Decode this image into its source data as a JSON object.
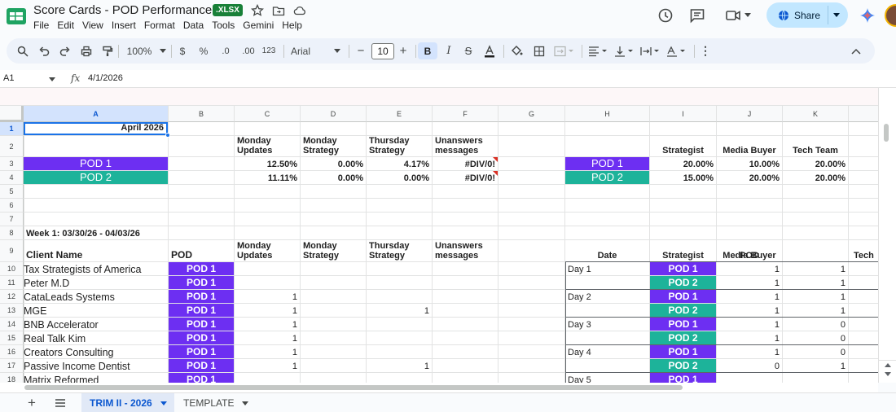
{
  "doc": {
    "title": "Score Cards - POD Performance",
    "format_badge": ".XLSX"
  },
  "menu": [
    "File",
    "Edit",
    "View",
    "Insert",
    "Format",
    "Data",
    "Tools",
    "Gemini",
    "Help"
  ],
  "share": {
    "label": "Share"
  },
  "toolbar": {
    "zoom": "100%",
    "currency": "$",
    "percent": "%",
    "dec_decrease": ".0",
    "dec_increase": ".00",
    "number_format": "123",
    "font": "Arial",
    "font_size": "10",
    "bold": "B"
  },
  "formula_bar": {
    "cell_ref": "A1",
    "fx": "fx",
    "value": "4/1/2026"
  },
  "columns": [
    "A",
    "B",
    "C",
    "D",
    "E",
    "F",
    "G",
    "H",
    "I",
    "J",
    "K"
  ],
  "rows": [
    "1",
    "2",
    "3",
    "4",
    "5",
    "6",
    "7",
    "8",
    "9",
    "10",
    "11",
    "12",
    "13",
    "14",
    "15",
    "16",
    "17",
    "18"
  ],
  "summary": {
    "month": "April 2026",
    "headers": [
      [
        "Monday",
        "Updates"
      ],
      [
        "Monday",
        "Strategy"
      ],
      [
        "Thursday",
        "Strategy"
      ],
      [
        "Unanswers",
        "messages"
      ]
    ],
    "pods": [
      {
        "name": "POD 1",
        "values": [
          "12.50%",
          "0.00%",
          "4.17%",
          "#DIV/0!"
        ]
      },
      {
        "name": "POD 2",
        "values": [
          "11.11%",
          "0.00%",
          "0.00%",
          "#DIV/0!"
        ]
      }
    ],
    "role_headers": [
      "Strategist",
      "Media Buyer",
      "Tech Team"
    ],
    "role_pods": [
      {
        "name": "POD 1",
        "values": [
          "20.00%",
          "10.00%",
          "20.00%"
        ]
      },
      {
        "name": "POD 2",
        "values": [
          "15.00%",
          "20.00%",
          "20.00%"
        ]
      }
    ]
  },
  "week": {
    "title": "Week 1: 03/30/26 - 04/03/26",
    "client_header": "Client Name",
    "pod_header": "POD",
    "clients": [
      {
        "name": "Tax Strategists of America",
        "pod": "POD 1",
        "mu": "",
        "ms": "",
        "ts": "",
        "um": ""
      },
      {
        "name": "Peter M.D",
        "pod": "POD 1",
        "mu": "",
        "ms": "",
        "ts": "",
        "um": ""
      },
      {
        "name": "CataLeads Systems",
        "pod": "POD 1",
        "mu": "1",
        "ms": "",
        "ts": "",
        "um": ""
      },
      {
        "name": "MGE",
        "pod": "POD 1",
        "mu": "1",
        "ms": "",
        "ts": "1",
        "um": ""
      },
      {
        "name": "BNB Accelerator",
        "pod": "POD 1",
        "mu": "1",
        "ms": "",
        "ts": "",
        "um": ""
      },
      {
        "name": "Real Talk Kim",
        "pod": "POD 1",
        "mu": "1",
        "ms": "",
        "ts": "",
        "um": ""
      },
      {
        "name": "Creators Consulting",
        "pod": "POD 1",
        "mu": "1",
        "ms": "",
        "ts": "",
        "um": ""
      },
      {
        "name": "Passive Income Dentist",
        "pod": "POD 1",
        "mu": "1",
        "ms": "",
        "ts": "1",
        "um": ""
      },
      {
        "name": "Matrix Reformed",
        "pod": "POD 1",
        "mu": "",
        "ms": "",
        "ts": "",
        "um": ""
      }
    ],
    "daily_headers": {
      "date": "Date",
      "pod": "POD",
      "strategist": "Strategist",
      "media_buyer": "Media Buyer",
      "tech": "Tech"
    },
    "daily": [
      {
        "day": "Day 1",
        "pod": "POD 1",
        "strategist": "1",
        "media_buyer": "1"
      },
      {
        "day": "",
        "pod": "POD 2",
        "strategist": "1",
        "media_buyer": "1"
      },
      {
        "day": "Day 2",
        "pod": "POD 1",
        "strategist": "1",
        "media_buyer": "1"
      },
      {
        "day": "",
        "pod": "POD 2",
        "strategist": "1",
        "media_buyer": "1"
      },
      {
        "day": "Day 3",
        "pod": "POD 1",
        "strategist": "1",
        "media_buyer": "0"
      },
      {
        "day": "",
        "pod": "POD 2",
        "strategist": "1",
        "media_buyer": "0"
      },
      {
        "day": "Day 4",
        "pod": "POD 1",
        "strategist": "1",
        "media_buyer": "0"
      },
      {
        "day": "",
        "pod": "POD 2",
        "strategist": "0",
        "media_buyer": "1"
      },
      {
        "day": "Day 5",
        "pod": "POD 1",
        "strategist": "",
        "media_buyer": ""
      }
    ]
  },
  "sheets": [
    {
      "label": "TRIM II - 2026",
      "active": true
    },
    {
      "label": "TEMPLATE",
      "active": false
    }
  ],
  "colors": {
    "pod1": "#6d2ff2",
    "pod2": "#1db39a",
    "accent": "#0b57d0",
    "share_bg": "#c2e7ff"
  }
}
